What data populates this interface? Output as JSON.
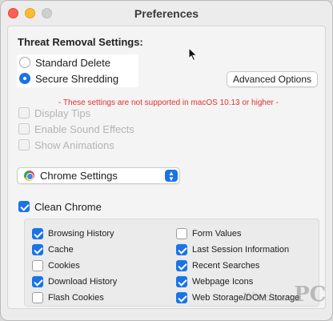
{
  "window": {
    "title": "Preferences"
  },
  "threat": {
    "title": "Threat Removal Settings:",
    "options": [
      {
        "label": "Standard Delete",
        "selected": false
      },
      {
        "label": "Secure Shredding",
        "selected": true
      }
    ],
    "advanced_button": "Advanced Options",
    "warning": "- These settings are not supported in macOS 10.13 or higher -"
  },
  "disabled_options": [
    {
      "label": "Display Tips",
      "checked": false
    },
    {
      "label": "Enable Sound Effects",
      "checked": false
    },
    {
      "label": "Show Animations",
      "checked": false
    }
  ],
  "browser_select": {
    "selected": "Chrome Settings"
  },
  "clean": {
    "label": "Clean Chrome",
    "checked": true,
    "left_items": [
      {
        "label": "Browsing History",
        "checked": true
      },
      {
        "label": "Cache",
        "checked": true
      },
      {
        "label": "Cookies",
        "checked": false
      },
      {
        "label": "Download History",
        "checked": true
      },
      {
        "label": "Flash Cookies",
        "checked": false
      }
    ],
    "right_items": [
      {
        "label": "Form Values",
        "checked": false
      },
      {
        "label": "Last Session Information",
        "checked": true
      },
      {
        "label": "Recent Searches",
        "checked": true
      },
      {
        "label": "Webpage Icons",
        "checked": true
      },
      {
        "label": "Web Storage/DOM Storage",
        "checked": true
      }
    ]
  },
  "watermark": {
    "script": "Windows",
    "mark": "PC"
  },
  "colors": {
    "accent": "#1a73e8",
    "warning": "#e0322f"
  }
}
